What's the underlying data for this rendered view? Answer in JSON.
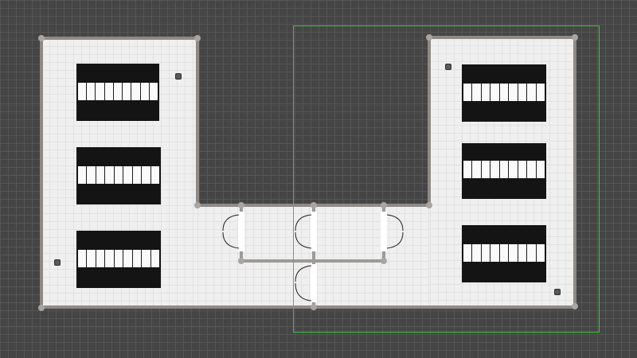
{
  "canvas": {
    "name": "floor-plan-editor",
    "background": "#454545",
    "grid_color": "#555555"
  },
  "colors": {
    "floor": "#efefef",
    "wall": "#8f8a86",
    "table": "#141414",
    "selection": "#33cc33",
    "door": "#ffffff"
  },
  "rooms": [
    {
      "id": "room-left",
      "tables": 3,
      "objects": 2
    },
    {
      "id": "room-right",
      "tables": 3,
      "objects": 2
    },
    {
      "id": "corridor-top",
      "doors": 4
    },
    {
      "id": "corridor-bottom",
      "doors": 1
    }
  ],
  "table_seat_count": 9,
  "selection": {
    "active": true
  }
}
